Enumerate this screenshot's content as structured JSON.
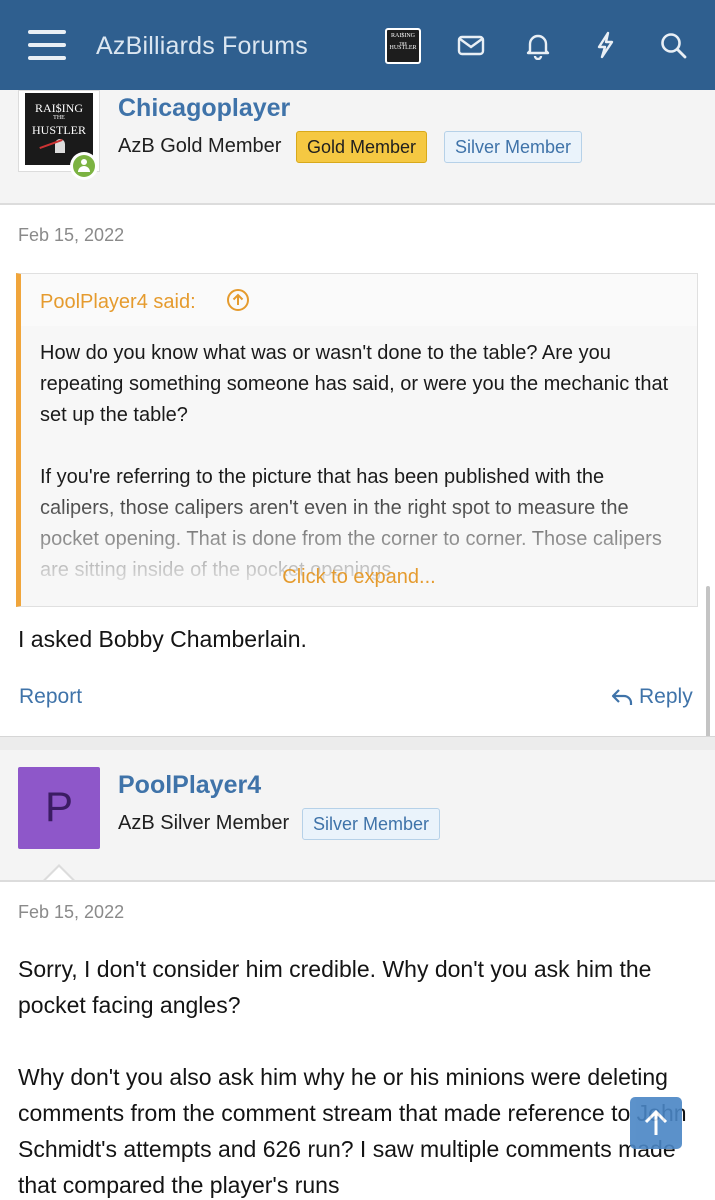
{
  "header": {
    "site_title": "AzBilliards Forums",
    "avatar_text": [
      "RAI$ING",
      "THE",
      "HUSTLER"
    ],
    "icons": [
      "menu-icon",
      "mail-icon",
      "bell-icon",
      "bolt-icon",
      "search-icon"
    ],
    "bar_color": "#2f5f8f"
  },
  "posts": [
    {
      "username": "Chicagoplayer",
      "user_title": "AzB Gold Member",
      "badges": [
        "Gold Member",
        "Silver Member"
      ],
      "avatar_text": [
        "RAI$ING",
        "THE",
        "HUSTLER"
      ],
      "online": true,
      "date": "Feb 15, 2022",
      "quote": {
        "attribution": "PoolPlayer4 said:",
        "paragraphs": [
          "How do you know what was or wasn't done to the table? Are you repeating something someone has said, or were you the mechanic that set up the table?",
          "If you're referring to the picture that has been published with the calipers, those calipers aren't even in the right spot to measure the pocket opening. That is done from the corner to corner. Those calipers are sitting inside of the pocket openings"
        ],
        "expand_label": "Click to expand..."
      },
      "body": "I asked Bobby Chamberlain.",
      "actions": {
        "report": "Report",
        "reply": "Reply"
      }
    },
    {
      "username": "PoolPlayer4",
      "user_title": "AzB Silver Member",
      "badges": [
        "Silver Member"
      ],
      "avatar_letter": "P",
      "avatar_color": "#8e57c9",
      "date": "Feb 15, 2022",
      "paragraphs": [
        "Sorry, I don't consider him credible. Why don't you ask him the pocket facing angles?",
        "Why don't you also ask him why he or his minions were deleting comments from the comment stream that made reference to John Schmidt's attempts and 626 run? I saw multiple comments made that compared the player's runs"
      ]
    }
  ],
  "colors": {
    "accent": "#3f73a9",
    "quote_accent": "#f0a53b",
    "gold_badge": "#f5c842"
  }
}
